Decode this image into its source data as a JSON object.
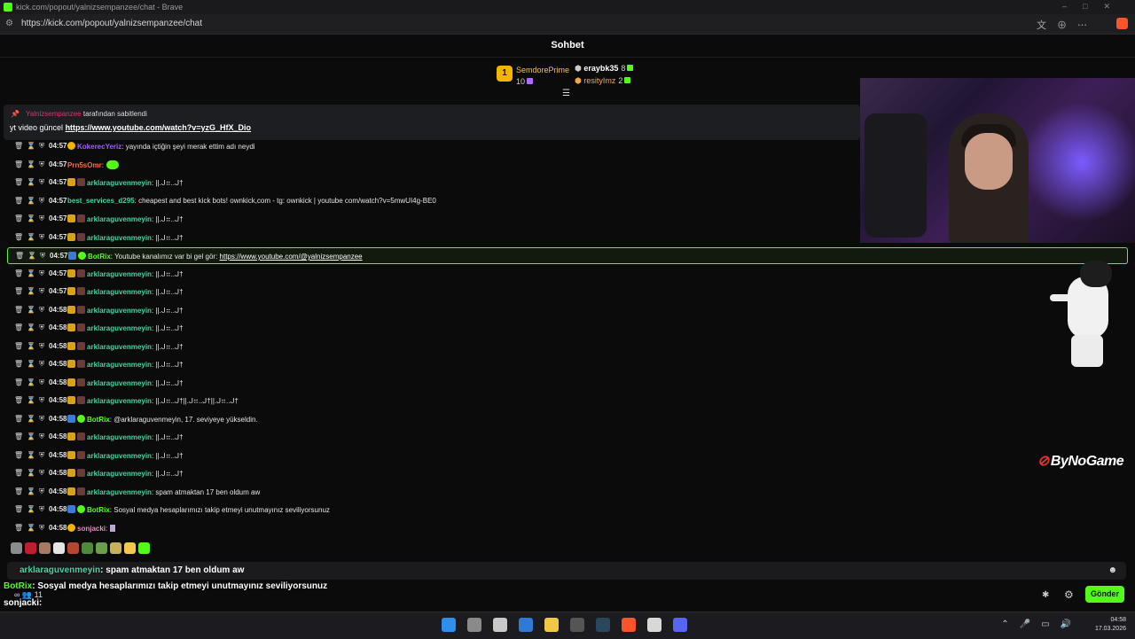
{
  "browser": {
    "title": "kick.com/popout/yalnizsempanzee/chat - Brave",
    "url": "https://kick.com/popout/yalnizsempanzee/chat"
  },
  "chat_header": {
    "title": "Sohbet"
  },
  "gifters": [
    {
      "rank": "1",
      "name": "SemdorePrime",
      "count": "10"
    },
    {
      "name": "eraybk35",
      "count": "8"
    },
    {
      "name": "resityImz",
      "count": "2"
    }
  ],
  "pinned": {
    "pinned_by": "Yalnizsempanzee",
    "pinned_suffix": "tarafından sabitlendi",
    "text_prefix": "yt video güncel",
    "link": "https://www.youtube.com/watch?v=yzG_HfX_Dio"
  },
  "messages": [
    {
      "time": "04:57",
      "badges": [
        "coin"
      ],
      "user": "KokerecYeriz",
      "color": "purple",
      "text": ": yayında içtiğin şeyi merak ettim adı neydi"
    },
    {
      "time": "04:57",
      "badges": [],
      "user": "Prn5sOmr",
      "color": "orange",
      "text": ":",
      "emote": true
    },
    {
      "time": "04:57",
      "badges": [
        "crown",
        "sub"
      ],
      "user": "arklaraguvenmeyin",
      "color": "teal",
      "text": ": ||.ᒍ⠶..ᒍ†"
    },
    {
      "time": "04:57",
      "badges": [],
      "user": "best_services_d295",
      "color": "teal",
      "text": ": cheapest and best kick bots! ownkick,com - tg: ownkick | youtube com/watch?v=5mwUI4g-BE0"
    },
    {
      "time": "04:57",
      "badges": [
        "crown",
        "sub"
      ],
      "user": "arklaraguvenmeyin",
      "color": "teal",
      "text": ": ||.ᒍ⠶..ᒍ†"
    },
    {
      "time": "04:57",
      "badges": [
        "crown",
        "sub"
      ],
      "user": "arklaraguvenmeyin",
      "color": "teal",
      "text": ": ||.ᒍ⠶..ᒍ†"
    },
    {
      "time": "04:57",
      "badges": [
        "bot",
        "ver"
      ],
      "user": "BotRix",
      "color": "bot",
      "text": ": Youtube kanalımız var bi gel gör: ",
      "link": "https://www.youtube.com/@yalnizsempanzee",
      "highlight": true
    },
    {
      "time": "04:57",
      "badges": [
        "crown",
        "sub"
      ],
      "user": "arklaraguvenmeyin",
      "color": "teal",
      "text": ": ||.ᒍ⠶..ᒍ†"
    },
    {
      "time": "04:57",
      "badges": [
        "crown",
        "sub"
      ],
      "user": "arklaraguvenmeyin",
      "color": "teal",
      "text": ": ||.ᒍ⠶..ᒍ†"
    },
    {
      "time": "04:58",
      "badges": [
        "crown",
        "sub"
      ],
      "user": "arklaraguvenmeyin",
      "color": "teal",
      "text": ": ||.ᒍ⠶..ᒍ†"
    },
    {
      "time": "04:58",
      "badges": [
        "crown",
        "sub"
      ],
      "user": "arklaraguvenmeyin",
      "color": "teal",
      "text": ": ||.ᒍ⠶..ᒍ†"
    },
    {
      "time": "04:58",
      "badges": [
        "crown",
        "sub"
      ],
      "user": "arklaraguvenmeyin",
      "color": "teal",
      "text": ": ||.ᒍ⠶..ᒍ†"
    },
    {
      "time": "04:58",
      "badges": [
        "crown",
        "sub"
      ],
      "user": "arklaraguvenmeyin",
      "color": "teal",
      "text": ": ||.ᒍ⠶..ᒍ†"
    },
    {
      "time": "04:58",
      "badges": [
        "crown",
        "sub"
      ],
      "user": "arklaraguvenmeyin",
      "color": "teal",
      "text": ": ||.ᒍ⠶..ᒍ†"
    },
    {
      "time": "04:58",
      "badges": [
        "crown",
        "sub"
      ],
      "user": "arklaraguvenmeyin",
      "color": "teal",
      "text": ": ||.ᒍ⠶..ᒍ†||.ᒍ⠶..ᒍ†||.ᒍ⠶..ᒍ†"
    },
    {
      "time": "04:58",
      "badges": [
        "bot",
        "ver"
      ],
      "user": "BotRix",
      "color": "bot",
      "text": ": @arklaraguvenmeyin, 17. seviyeye yükseldin."
    },
    {
      "time": "04:58",
      "badges": [
        "crown",
        "sub"
      ],
      "user": "arklaraguvenmeyin",
      "color": "teal",
      "text": ": ||.ᒍ⠶..ᒍ†"
    },
    {
      "time": "04:58",
      "badges": [
        "crown",
        "sub"
      ],
      "user": "arklaraguvenmeyin",
      "color": "teal",
      "text": ": ||.ᒍ⠶..ᒍ†"
    },
    {
      "time": "04:58",
      "badges": [
        "crown",
        "sub"
      ],
      "user": "arklaraguvenmeyin",
      "color": "teal",
      "text": ": ||.ᒍ⠶..ᒍ†"
    },
    {
      "time": "04:58",
      "badges": [
        "crown",
        "sub"
      ],
      "user": "arklaraguvenmeyin",
      "color": "teal",
      "text": ": spam atmaktan 17 ben oldum aw"
    },
    {
      "time": "04:58",
      "badges": [
        "bot",
        "ver"
      ],
      "user": "BotRix",
      "color": "bot",
      "text": ": Sosyal medya hesaplarımızı takip etmeyi unutmayınız seviliyorsunuz"
    },
    {
      "time": "04:58",
      "badges": [
        "coin"
      ],
      "user": "sonjacki",
      "color": "pink",
      "text": ":",
      "emote2": true
    }
  ],
  "overlay_chat": {
    "line1_user": "arklaraguvenmeyin",
    "line1_text": ": spam atmaktan 17 ben oldum aw",
    "line2_user": "BotRix",
    "line2_text": ": Sosyal medya hesaplarımızı takip etmeyi unutmayınız seviliyorsunuz",
    "line3_user": "sonjacki",
    "line3_text": ":",
    "viewer_count": "11"
  },
  "send_button": "Gönder",
  "watermark": "ByNoGame",
  "clock": {
    "time": "04:58",
    "date": "17.03.2026"
  },
  "colors": {
    "accent": "#53fc18",
    "background": "#0b0b0c"
  }
}
